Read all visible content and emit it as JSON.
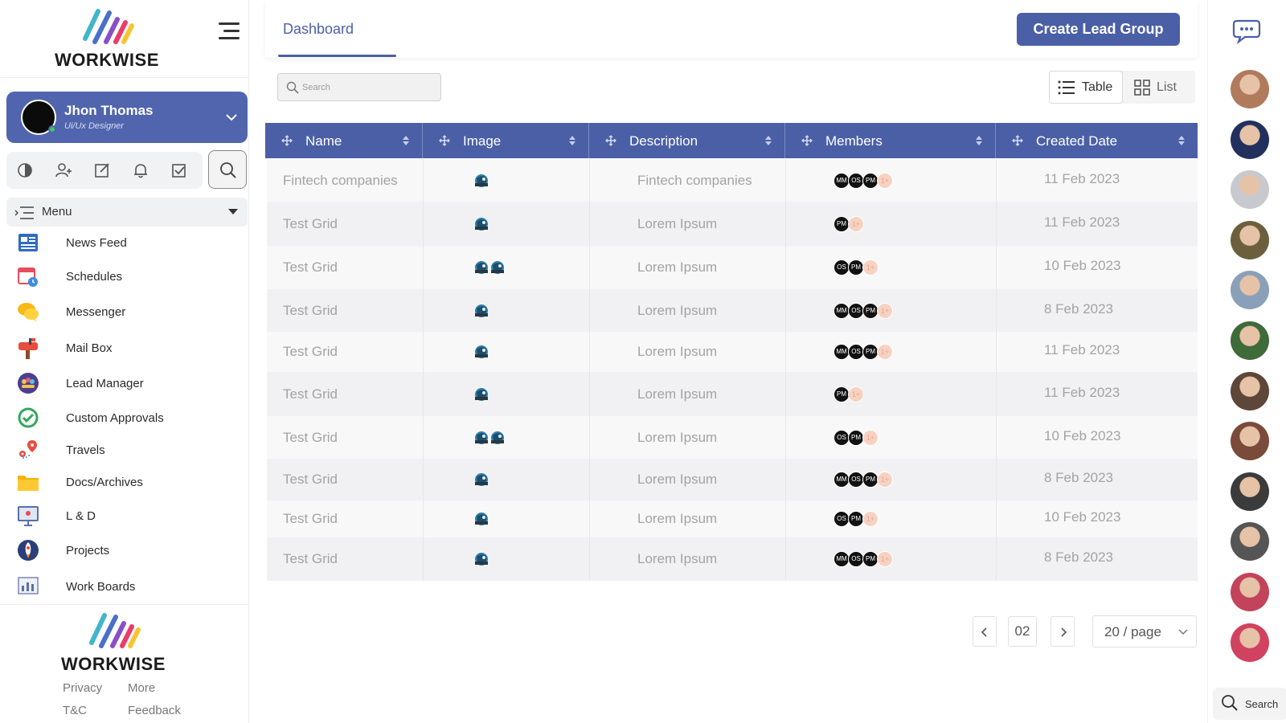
{
  "brand": {
    "name": "WORKWISE"
  },
  "profile": {
    "name": "Jhon Thomas",
    "role": "Ui/Ux Designer"
  },
  "quick_actions": [
    "theme-icon",
    "add-user-icon",
    "edit-icon",
    "bell-icon",
    "checkbox-icon"
  ],
  "menu": {
    "header": "Menu",
    "items": [
      {
        "label": "News Feed",
        "icon": "news-feed-icon"
      },
      {
        "label": "Schedules",
        "icon": "calendar-icon"
      },
      {
        "label": "Messenger",
        "icon": "chat-bubbles-icon"
      },
      {
        "label": "Mail Box",
        "icon": "mailbox-icon"
      },
      {
        "label": "Lead Manager",
        "icon": "lead-manager-icon"
      },
      {
        "label": "Custom Approvals",
        "icon": "approval-check-icon"
      },
      {
        "label": "Travels",
        "icon": "map-pin-icon"
      },
      {
        "label": "Docs/Archives",
        "icon": "folder-icon"
      },
      {
        "label": "L & D",
        "icon": "presentation-board-icon"
      },
      {
        "label": "Projects",
        "icon": "rocket-icon"
      },
      {
        "label": "Work Boards",
        "icon": "board-chart-icon"
      }
    ]
  },
  "footer": {
    "privacy": "Privacy",
    "more": "More",
    "tc": "T&C",
    "feedback": "Feedback"
  },
  "header": {
    "tab": "Dashboard",
    "create_button": "Create Lead Group"
  },
  "search": {
    "placeholder": "Search"
  },
  "view": {
    "table_label": "Table",
    "list_label": "List",
    "active": "Table"
  },
  "table": {
    "columns": [
      "Name",
      "Image",
      "Description",
      "Members",
      "Created Date"
    ],
    "rows": [
      {
        "name": "Fintech companies",
        "images": 1,
        "description": "Fintech companies",
        "members": [
          "MM",
          "OS",
          "PM"
        ],
        "more": "1+",
        "date": "11 Feb 2023"
      },
      {
        "name": "Test Grid",
        "images": 1,
        "description": "Lorem Ipsum",
        "members": [
          "PM"
        ],
        "more": "1+",
        "date": "11 Feb 2023"
      },
      {
        "name": "Test Grid",
        "images": 2,
        "description": "Lorem Ipsum",
        "members": [
          "OS",
          "PM"
        ],
        "more": "1+",
        "date": "10 Feb 2023"
      },
      {
        "name": "Test Grid",
        "images": 1,
        "description": "Lorem Ipsum",
        "members": [
          "MM",
          "OS",
          "PM"
        ],
        "more": "1+",
        "date": "8 Feb 2023"
      },
      {
        "name": "Test Grid",
        "images": 1,
        "description": "Lorem Ipsum",
        "members": [
          "MM",
          "OS",
          "PM"
        ],
        "more": "1+",
        "date": "11 Feb 2023"
      },
      {
        "name": "Test Grid",
        "images": 1,
        "description": "Lorem Ipsum",
        "members": [
          "PM"
        ],
        "more": "1+",
        "date": "11 Feb 2023"
      },
      {
        "name": "Test Grid",
        "images": 2,
        "description": "Lorem Ipsum",
        "members": [
          "OS",
          "PM"
        ],
        "more": "1+",
        "date": "10 Feb 2023"
      },
      {
        "name": "Test Grid",
        "images": 1,
        "description": "Lorem Ipsum",
        "members": [
          "MM",
          "OS",
          "PM"
        ],
        "more": "1+",
        "date": "8 Feb 2023"
      },
      {
        "name": "Test Grid",
        "images": 1,
        "description": "Lorem Ipsum",
        "members": [
          "OS",
          "PM"
        ],
        "more": "1+",
        "date": "10 Feb 2023"
      },
      {
        "name": "Test Grid",
        "images": 1,
        "description": "Lorem Ipsum",
        "members": [
          "MM",
          "OS",
          "PM"
        ],
        "more": "1+",
        "date": "8 Feb 2023"
      }
    ]
  },
  "pagination": {
    "current_page": "02",
    "page_size": "20 / page"
  },
  "right_rail": {
    "search_label": "Search",
    "avatar_colors": [
      "#b07a5c",
      "#22305e",
      "#c7c9cf",
      "#6b5f3e",
      "#8aa0b8",
      "#3f6b3a",
      "#5e4638",
      "#7a4a3a",
      "#3b3b3b",
      "#555555",
      "#c2435c",
      "#d0425f"
    ]
  },
  "colors": {
    "primary": "#4b5fa6",
    "profile_bg": "#5065ad",
    "online": "#3cc76b"
  }
}
